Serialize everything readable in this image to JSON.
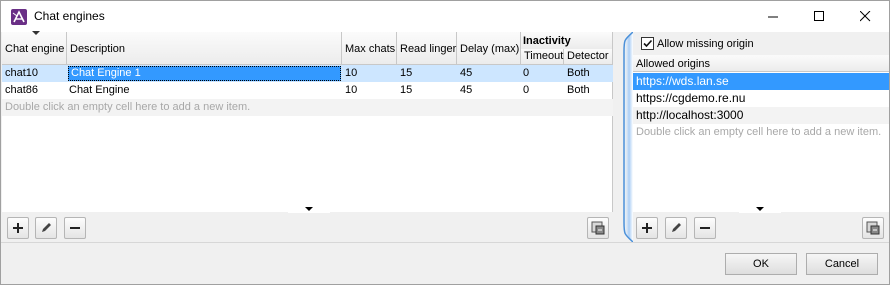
{
  "window": {
    "title": "Chat engines"
  },
  "engines_table": {
    "columns": {
      "chat_engine": "Chat engine",
      "description": "Description",
      "max_chats": "Max chats",
      "read_linger": "Read linger",
      "delay_max": "Delay (max)",
      "inactivity_group": "Inactivity",
      "timeout": "Timeout",
      "detector": "Detector"
    },
    "rows": [
      {
        "chat_engine": "chat10",
        "description": "Chat Engine 1",
        "max_chats": "10",
        "read_linger": "15",
        "delay_max": "45",
        "timeout": "0",
        "detector": "Both"
      },
      {
        "chat_engine": "chat86",
        "description": "Chat Engine",
        "max_chats": "10",
        "read_linger": "15",
        "delay_max": "45",
        "timeout": "0",
        "detector": "Both"
      }
    ],
    "add_hint": "Double click an empty cell here to add a new item."
  },
  "origins": {
    "allow_missing_label": "Allow missing origin",
    "allow_missing_checked": true,
    "header": "Allowed origins",
    "items": [
      "https://wds.lan.se",
      "https://cgdemo.re.nu",
      "http://localhost:3000"
    ],
    "add_hint": "Double click an empty cell here to add a new item."
  },
  "buttons": {
    "ok": "OK",
    "cancel": "Cancel"
  },
  "icons": {
    "add": "plus-icon",
    "edit": "pencil-icon",
    "remove": "minus-icon",
    "export": "export-icon"
  },
  "colors": {
    "selection": "#3399ff",
    "row_highlight": "#cde6ff",
    "app_icon": "#6a2f86"
  }
}
